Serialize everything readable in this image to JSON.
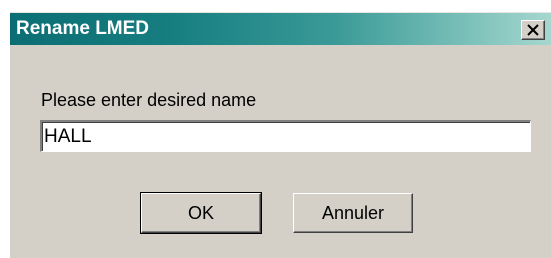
{
  "dialog": {
    "title": "Rename LMED",
    "close_label": "X",
    "prompt": "Please enter desired name",
    "name_value": "HALL",
    "ok_label": "OK",
    "cancel_label": "Annuler"
  },
  "colors": {
    "titlebar_start": "#0b6e74",
    "titlebar_end": "#a6d7cf",
    "dialog_face": "#d4d0c8"
  },
  "icons": {
    "close": "close-icon"
  }
}
